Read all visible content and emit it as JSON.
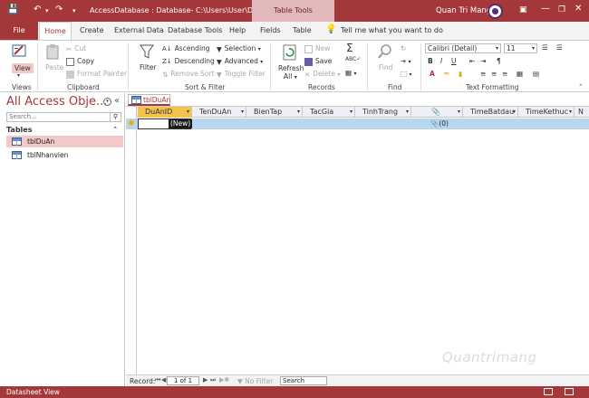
{
  "app": {
    "title": "AccessDatabase : Database- C:\\Users\\User\\Docu...",
    "contextual_tab": "Table Tools",
    "user": "Quan Tri Mang"
  },
  "ribbon_tabs": [
    "File",
    "Home",
    "Create",
    "External Data",
    "Database Tools",
    "Help",
    "Fields",
    "Table"
  ],
  "tell_me": "Tell me what you want to do",
  "views": {
    "view_label": "View",
    "group": "Views"
  },
  "clipboard": {
    "paste": "Paste",
    "cut": "Cut",
    "copy": "Copy",
    "format_painter": "Format Painter",
    "group": "Clipboard"
  },
  "sort_filter": {
    "filter": "Filter",
    "ascending": "Ascending",
    "descending": "Descending",
    "remove_sort": "Remove Sort",
    "selection": "Selection",
    "advanced": "Advanced",
    "toggle_filter": "Toggle Filter",
    "group": "Sort & Filter"
  },
  "records": {
    "refresh": "Refresh",
    "refresh_all": "All",
    "new": "New",
    "save": "Save",
    "delete": "Delete",
    "group": "Records"
  },
  "find": {
    "find": "Find",
    "group": "Find"
  },
  "text_format": {
    "font": "Calibri (Detail)",
    "size": "11",
    "group": "Text Formatting"
  },
  "nav_pane": {
    "title": "All Access Obje...",
    "search_placeholder": "Search...",
    "section": "Tables",
    "items": [
      {
        "label": "tblDuAn",
        "selected": true
      },
      {
        "label": "tblNhanvien",
        "selected": false
      }
    ]
  },
  "document_tab": "tblDuAn",
  "datasheet": {
    "columns": [
      "DuAnID",
      "TenDuAn",
      "BienTap",
      "TacGia",
      "TinhTrang",
      "",
      "TimeBatdau",
      "TimeKethuc",
      "N"
    ],
    "new_row": {
      "id_value": "(New)",
      "attachment": "(0)"
    }
  },
  "record_nav": {
    "label": "Record:",
    "position": "1 of 1",
    "filter": "No Filter",
    "search_placeholder": "Search"
  },
  "status": {
    "text": "Datasheet View"
  },
  "watermark": "Quantrimang",
  "colors": {
    "accent": "#a4373a",
    "selected_header": "#f3c34d",
    "selected_row": "#b7d7ef"
  }
}
